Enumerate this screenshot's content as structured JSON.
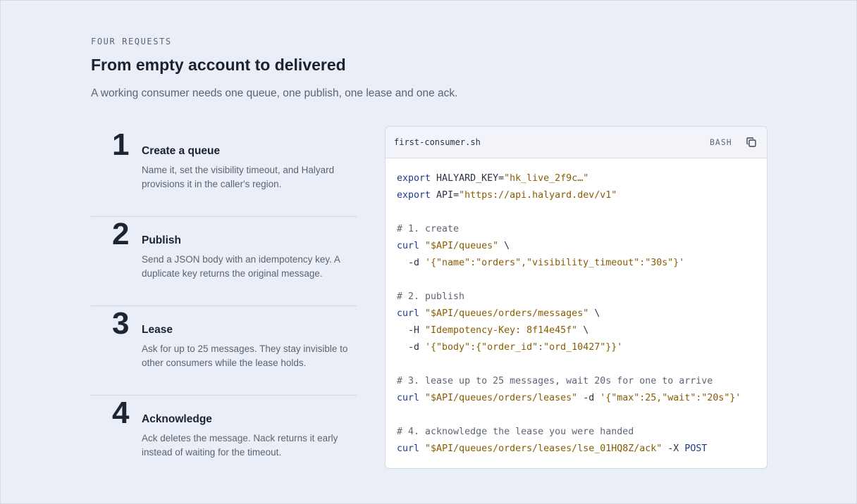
{
  "header": {
    "eyebrow": "FOUR REQUESTS",
    "title": "From empty account to delivered",
    "subtitle": "A working consumer needs one queue, one publish, one lease and one ack."
  },
  "steps": [
    {
      "number": "1",
      "title": "Create a queue",
      "desc": "Name it, set the visibility timeout, and Halyard provisions it in the caller's region."
    },
    {
      "number": "2",
      "title": "Publish",
      "desc": "Send a JSON body with an idempotency key. A duplicate key returns the original message."
    },
    {
      "number": "3",
      "title": "Lease",
      "desc": "Ask for up to 25 messages. They stay invisible to other consumers while the lease holds."
    },
    {
      "number": "4",
      "title": "Acknowledge",
      "desc": "Ack deletes the message. Nack returns it early instead of waiting for the timeout."
    }
  ],
  "code": {
    "filename": "first-consumer.sh",
    "language": "BASH",
    "copy_icon": "copy-icon",
    "lines": [
      [
        [
          "kw",
          "export"
        ],
        [
          "p",
          " HALYARD_KEY="
        ],
        [
          "str",
          "\"hk_live_2f9c…\""
        ]
      ],
      [
        [
          "kw",
          "export"
        ],
        [
          "p",
          " API="
        ],
        [
          "str",
          "\"https://api.halyard.dev/v1\""
        ]
      ],
      [],
      [
        [
          "cm",
          "# 1. create"
        ]
      ],
      [
        [
          "kw",
          "curl"
        ],
        [
          "p",
          " "
        ],
        [
          "str",
          "\"$API/queues\""
        ],
        [
          "p",
          " \\"
        ]
      ],
      [
        [
          "p",
          "  -d "
        ],
        [
          "str",
          "'{\"name\":\"orders\",\"visibility_timeout\":\"30s\"}'"
        ]
      ],
      [],
      [
        [
          "cm",
          "# 2. publish"
        ]
      ],
      [
        [
          "kw",
          "curl"
        ],
        [
          "p",
          " "
        ],
        [
          "str",
          "\"$API/queues/orders/messages\""
        ],
        [
          "p",
          " \\"
        ]
      ],
      [
        [
          "p",
          "  -H "
        ],
        [
          "str",
          "\"Idempotency-Key: 8f14e45f\""
        ],
        [
          "p",
          " \\"
        ]
      ],
      [
        [
          "p",
          "  -d "
        ],
        [
          "str",
          "'{\"body\":{\"order_id\":\"ord_10427\"}}'"
        ]
      ],
      [],
      [
        [
          "cm",
          "# 3. lease up to 25 messages, wait 20s for one to arrive"
        ]
      ],
      [
        [
          "kw",
          "curl"
        ],
        [
          "p",
          " "
        ],
        [
          "str",
          "\"$API/queues/orders/leases\""
        ],
        [
          "p",
          " -d "
        ],
        [
          "str",
          "'{\"max\":25,\"wait\":\"20s\"}'"
        ]
      ],
      [],
      [
        [
          "cm",
          "# 4. acknowledge the lease you were handed"
        ]
      ],
      [
        [
          "kw",
          "curl"
        ],
        [
          "p",
          " "
        ],
        [
          "str",
          "\"$API/queues/orders/leases/lse_01HQ8Z/ack\""
        ],
        [
          "p",
          " -X "
        ],
        [
          "kw",
          "POST"
        ]
      ]
    ]
  },
  "colors": {
    "background": "#eaeef7",
    "keyword": "#1e3a8a",
    "string": "#8a5a00",
    "comment": "#5d6676"
  }
}
